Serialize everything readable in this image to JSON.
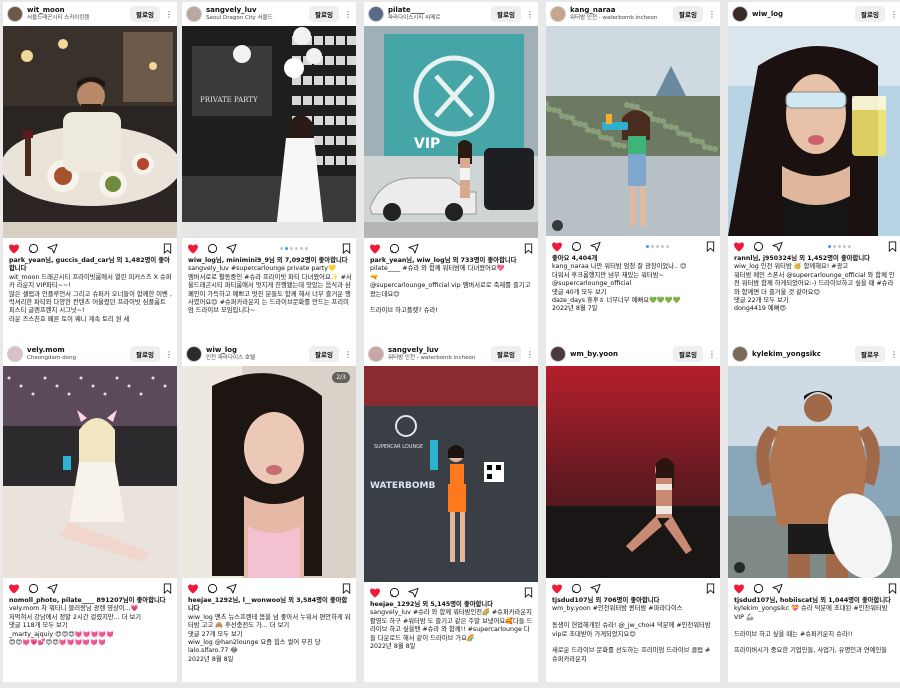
{
  "follow_label": "팔로잉",
  "follow_label_alt": "팔로우",
  "posts": [
    {
      "username": "wit_moon",
      "location": "서울드래곤시티 스카이킹텐",
      "likes": "park_yean님, guccis_dad_car님 외 1,482명이 좋아합니다",
      "caption": "wit_moon 드래곤시티 프라이빗룸에서 열린 피커스즈 X 슈퍼카 라운지 VIP파티~~!\n많은 셀럽과 인플루언서 그리고 슈퍼카 오너들이 함께한 이벤 , 럭셔리한 파티와 다양한 컨텐츠 어울렸던 프라이빗 심플룸트 피스티 글렌프렌지 시그넛~!\n라운 즈스친호 페른 토이 웨니 계속 토리 원 세"
    },
    {
      "username": "sangvely_luv",
      "location": "Seoul Dragon City 서울드",
      "likes": "wiw_log님, minimini9_9님 외 7,092명이 좋아합니다",
      "caption": "sangvely_luv #supercarlounge private party💛\n엠버서로로 활동중인 #슈라 프라이빗 파티 다녀왔어요✨ #서울드래곤시티 파티룸에서 멋지게 진행됐는데 맛있는 음식과 샴페인이 가득하고 예쁘고 멋진 분들도 함께 해서 너무 즐거운 행사였어요😊 #슈퍼카라운지 는 드라이브문화를 만드는 프리미엄 드라이브 모임입니다~"
    },
    {
      "username": "pilate____",
      "location": "파라다이스시티 씨메르",
      "likes": "park_yean님, wiw_log님 외 733명이 좋아합니다",
      "caption": "pilate____ #슈라 와 함께 워터밤에 다녀왔어요💖\n🔫\n@supercarlounge_official vip 멤버서로로 축제를 즐기고 왔는데요😊\n\n드라이브 하고플렛? 슈라!"
    },
    {
      "username": "kang_naraa",
      "location": "워터밤 인천 - waterbomb incheon",
      "likes": "좋아요 4,404개",
      "caption": "kang_naraa 나만 워터밤 엄청 잘 광장이었나.. 😊\n더워서 후크롬했지만 넘무 재밌는 워터밤~\n@supercarlounge_official\n댓글 40개 모두 보기\ndaze_days 휴후ㅎ 너무너무 예뻐요💚💚💚💚\n2022년 8월 7일"
    },
    {
      "username": "wiw_log",
      "location": "",
      "likes": "rannl님, j950324님 외 1,452명이 좋아합니다",
      "caption": "wiw_log 인천 워터밤 🥳 함께해요! #광고\n워터밤 메인 스폰서 @supercarlounge_official 와 함께 인천 워터밤 함께 하게되었어요:-) 드라이브하고 싶을 때 #슈라 와 함께면 더 즐거울 것 같아요😊\n댓글 22개 모두 보기\ndong4419 예뻐😍"
    },
    {
      "username": "vely.mom",
      "location": "Cheongdam-dong",
      "likes": "nomoll_photo, pilate____ 891207님이 좋아합니다",
      "caption": "vely.mom 차 뭐타니 블러랑님 광렌 영상이...💗\n저먹혀서 강남에서 정말 2시간 걸렸지만... 더 보기\n댓글 118개 모두 보기\n_marty_ajquiy 😍😍😍💓💓💓💓💓\n😍😍💓💗💕😍😍💓💓💓💓💓💓"
    },
    {
      "username": "wiw_log",
      "location": "인천 파라다이스 호텔",
      "likes": "heejae_1292님, l__wonwoo님 외 3,584명이 좋아합니다",
      "caption": "wiw_log 맨츠 뉴스프렌테 몸을 넘 좋아서 누워서 편안하게 워터밤 고고 🙈 후선충전도 가... 더 보기\n댓글 27개 모두 보기\nwiw_log @han2lounge 요즘 힘스 씰어 부친 당\nlalo.slfaro.77 😂\n2022년 8월 8일"
    },
    {
      "username": "sangvely_luv",
      "location": "워터밤 인천 - waterbomb incheon",
      "likes": "heejae_1292님 외 5,145명이 좋아합니다",
      "caption": "sangvely_luv #슈라 와 함께 워터밤인천🌈 #슈퍼카라운지 활영도 하구 #워터밤 도 즐기고 같은 주말 보냈어요🥰다들 드라이브 하고 싶을땐 #슈라 와 함께!! #supercarlounge 다들 다운로드 해서 같이 드라이브 가요🌈\n2022년 8월 8일"
    },
    {
      "username": "wm_by.yoon",
      "location": "",
      "likes": "tjsdud107님 외 706명이 좋아합니다",
      "caption": "wm_by.yoon #인천워터밤 퀸터밤 #파라다이스\n\n동생이 헌업해개된 슈라! @_jw_choi4 덕분에 #인천워터밤 vip로 초대받아 가게되었지요😊\n\n새로운 드라이브 문화를 선도하는 프리미엄 드라이브 클럽 #슈퍼카라운지"
    },
    {
      "username": "kylekim_yongsikc",
      "location": "",
      "likes": "tjsdud107님, hobiiscat님 외 1,044명이 좋아합니다",
      "caption": "kylekim_yongsikc 💝 슈라 덕분에 초대된 #인천워터밤 VIP 🦾\n\n드라이브 하고 싶을 때는 #슈퍼카운지 슈라!!\n\n프라이버시가 중요한 기업인들, 사업가, 유명인과 연예인들"
    }
  ]
}
